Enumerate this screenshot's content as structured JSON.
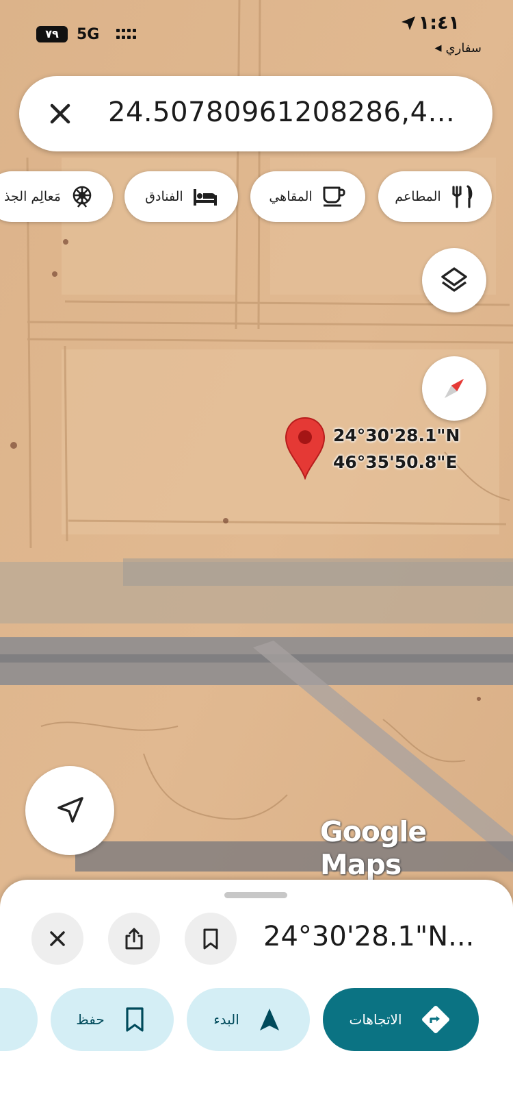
{
  "status_bar": {
    "battery": "٧٩",
    "network": "5G",
    "time": "١:٤١",
    "back_app": "سفاري"
  },
  "search": {
    "query": "24.50780961208286,4..."
  },
  "chips": [
    {
      "icon": "restaurant-icon",
      "label": "المطاعم"
    },
    {
      "icon": "coffee-icon",
      "label": "المقاهي"
    },
    {
      "icon": "hotel-icon",
      "label": "الفنادق"
    },
    {
      "icon": "attractions-icon",
      "label": "مَعالِم الجذ"
    }
  ],
  "pin": {
    "lat_label": "24°30'28.1\"N",
    "lng_label": "46°35'50.8\"E",
    "color": "#e53935"
  },
  "map": {
    "logo": "Google Maps"
  },
  "sheet": {
    "title": "24°30'28.1\"N...",
    "actions": [
      {
        "icon": "directions-icon",
        "label": "الاتجاهات"
      },
      {
        "icon": "navigate-icon",
        "label": "البدء"
      },
      {
        "icon": "bookmark-icon",
        "label": "حفظ"
      }
    ]
  },
  "colors": {
    "accent_dark": "#0b7383",
    "accent_light": "#d4eef5"
  }
}
